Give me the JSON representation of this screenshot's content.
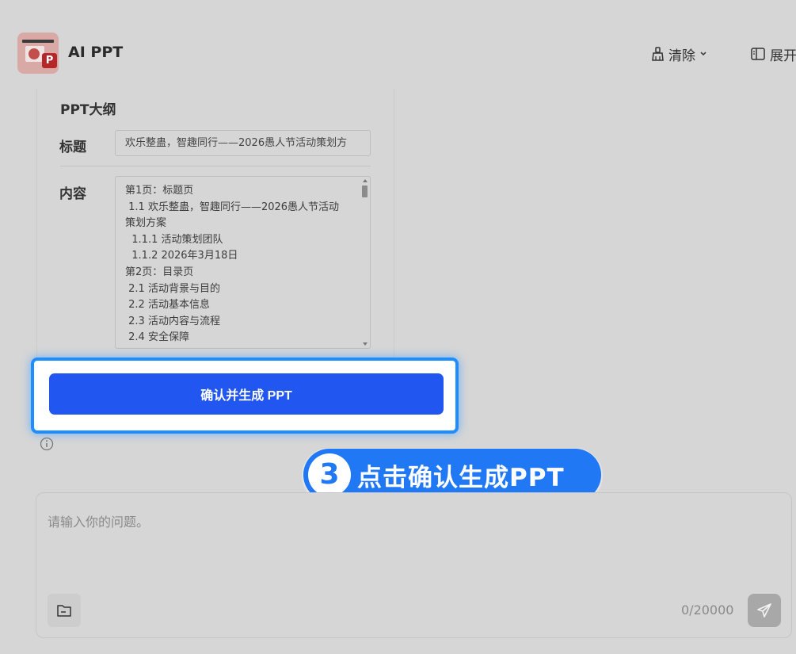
{
  "header": {
    "app_title": "AI PPT",
    "clear_label": "清除",
    "expand_label": "展开"
  },
  "outline": {
    "heading": "PPT大纲",
    "title_label": "标题",
    "title_value": "欢乐整蛊，智趣同行——2026愚人节活动策划方",
    "content_label": "内容",
    "content_lines": [
      "第1页：标题页",
      " 1.1 欢乐整蛊，智趣同行——2026愚人节活动",
      "策划方案",
      "  1.1.1 活动策划团队",
      "  1.1.2 2026年3月18日",
      "",
      "第2页：目录页",
      " 2.1 活动背景与目的",
      " 2.2 活动基本信息",
      " 2.3 活动内容与流程",
      " 2.4 安全保障"
    ]
  },
  "confirm_button": "确认并生成 PPT",
  "tip": {
    "number": "3",
    "text": "点击确认生成PPT"
  },
  "chat": {
    "placeholder": "请输入你的问题。",
    "counter": "0/20000"
  }
}
